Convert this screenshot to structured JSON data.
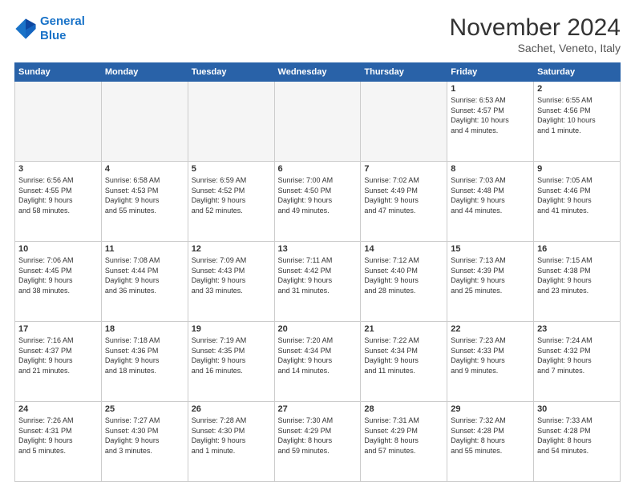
{
  "logo": {
    "line1": "General",
    "line2": "Blue"
  },
  "title": "November 2024",
  "location": "Sachet, Veneto, Italy",
  "weekdays": [
    "Sunday",
    "Monday",
    "Tuesday",
    "Wednesday",
    "Thursday",
    "Friday",
    "Saturday"
  ],
  "weeks": [
    [
      {
        "day": "",
        "info": ""
      },
      {
        "day": "",
        "info": ""
      },
      {
        "day": "",
        "info": ""
      },
      {
        "day": "",
        "info": ""
      },
      {
        "day": "",
        "info": ""
      },
      {
        "day": "1",
        "info": "Sunrise: 6:53 AM\nSunset: 4:57 PM\nDaylight: 10 hours\nand 4 minutes."
      },
      {
        "day": "2",
        "info": "Sunrise: 6:55 AM\nSunset: 4:56 PM\nDaylight: 10 hours\nand 1 minute."
      }
    ],
    [
      {
        "day": "3",
        "info": "Sunrise: 6:56 AM\nSunset: 4:55 PM\nDaylight: 9 hours\nand 58 minutes."
      },
      {
        "day": "4",
        "info": "Sunrise: 6:58 AM\nSunset: 4:53 PM\nDaylight: 9 hours\nand 55 minutes."
      },
      {
        "day": "5",
        "info": "Sunrise: 6:59 AM\nSunset: 4:52 PM\nDaylight: 9 hours\nand 52 minutes."
      },
      {
        "day": "6",
        "info": "Sunrise: 7:00 AM\nSunset: 4:50 PM\nDaylight: 9 hours\nand 49 minutes."
      },
      {
        "day": "7",
        "info": "Sunrise: 7:02 AM\nSunset: 4:49 PM\nDaylight: 9 hours\nand 47 minutes."
      },
      {
        "day": "8",
        "info": "Sunrise: 7:03 AM\nSunset: 4:48 PM\nDaylight: 9 hours\nand 44 minutes."
      },
      {
        "day": "9",
        "info": "Sunrise: 7:05 AM\nSunset: 4:46 PM\nDaylight: 9 hours\nand 41 minutes."
      }
    ],
    [
      {
        "day": "10",
        "info": "Sunrise: 7:06 AM\nSunset: 4:45 PM\nDaylight: 9 hours\nand 38 minutes."
      },
      {
        "day": "11",
        "info": "Sunrise: 7:08 AM\nSunset: 4:44 PM\nDaylight: 9 hours\nand 36 minutes."
      },
      {
        "day": "12",
        "info": "Sunrise: 7:09 AM\nSunset: 4:43 PM\nDaylight: 9 hours\nand 33 minutes."
      },
      {
        "day": "13",
        "info": "Sunrise: 7:11 AM\nSunset: 4:42 PM\nDaylight: 9 hours\nand 31 minutes."
      },
      {
        "day": "14",
        "info": "Sunrise: 7:12 AM\nSunset: 4:40 PM\nDaylight: 9 hours\nand 28 minutes."
      },
      {
        "day": "15",
        "info": "Sunrise: 7:13 AM\nSunset: 4:39 PM\nDaylight: 9 hours\nand 25 minutes."
      },
      {
        "day": "16",
        "info": "Sunrise: 7:15 AM\nSunset: 4:38 PM\nDaylight: 9 hours\nand 23 minutes."
      }
    ],
    [
      {
        "day": "17",
        "info": "Sunrise: 7:16 AM\nSunset: 4:37 PM\nDaylight: 9 hours\nand 21 minutes."
      },
      {
        "day": "18",
        "info": "Sunrise: 7:18 AM\nSunset: 4:36 PM\nDaylight: 9 hours\nand 18 minutes."
      },
      {
        "day": "19",
        "info": "Sunrise: 7:19 AM\nSunset: 4:35 PM\nDaylight: 9 hours\nand 16 minutes."
      },
      {
        "day": "20",
        "info": "Sunrise: 7:20 AM\nSunset: 4:34 PM\nDaylight: 9 hours\nand 14 minutes."
      },
      {
        "day": "21",
        "info": "Sunrise: 7:22 AM\nSunset: 4:34 PM\nDaylight: 9 hours\nand 11 minutes."
      },
      {
        "day": "22",
        "info": "Sunrise: 7:23 AM\nSunset: 4:33 PM\nDaylight: 9 hours\nand 9 minutes."
      },
      {
        "day": "23",
        "info": "Sunrise: 7:24 AM\nSunset: 4:32 PM\nDaylight: 9 hours\nand 7 minutes."
      }
    ],
    [
      {
        "day": "24",
        "info": "Sunrise: 7:26 AM\nSunset: 4:31 PM\nDaylight: 9 hours\nand 5 minutes."
      },
      {
        "day": "25",
        "info": "Sunrise: 7:27 AM\nSunset: 4:30 PM\nDaylight: 9 hours\nand 3 minutes."
      },
      {
        "day": "26",
        "info": "Sunrise: 7:28 AM\nSunset: 4:30 PM\nDaylight: 9 hours\nand 1 minute."
      },
      {
        "day": "27",
        "info": "Sunrise: 7:30 AM\nSunset: 4:29 PM\nDaylight: 8 hours\nand 59 minutes."
      },
      {
        "day": "28",
        "info": "Sunrise: 7:31 AM\nSunset: 4:29 PM\nDaylight: 8 hours\nand 57 minutes."
      },
      {
        "day": "29",
        "info": "Sunrise: 7:32 AM\nSunset: 4:28 PM\nDaylight: 8 hours\nand 55 minutes."
      },
      {
        "day": "30",
        "info": "Sunrise: 7:33 AM\nSunset: 4:28 PM\nDaylight: 8 hours\nand 54 minutes."
      }
    ]
  ]
}
